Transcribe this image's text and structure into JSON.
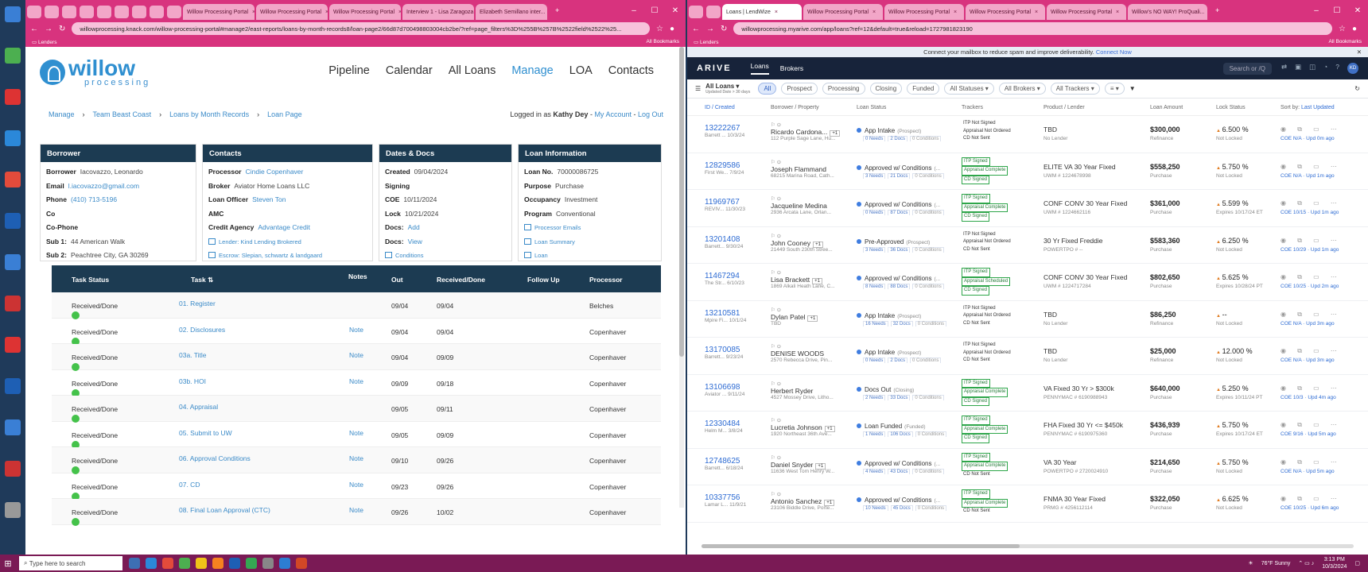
{
  "left_browser": {
    "tabs": [
      "Willow Processing Portal",
      "Willow Processing Portal",
      "Willow Processing Portal",
      "Interview 1 - Lisa Zaragoza",
      "Elizabeth Semillano inter..."
    ],
    "url": "willowprocessing.knack.com/willow-processing-portal#manage2/east-reports/loans-by-month-records8/loan-page2/66d87d700498803004cb2be/?ref=page_filters%3D%255B%257B%2522field%2522%25...",
    "bookmarks_folder": "Lenders",
    "all_bookmarks": "All Bookmarks"
  },
  "logo": {
    "word": "willow",
    "sub": "processing"
  },
  "main_nav": [
    "Pipeline",
    "Calendar",
    "All Loans",
    "Manage",
    "LOA",
    "Contacts"
  ],
  "active_nav": "Manage",
  "breadcrumb": [
    "Manage",
    "Team Beast Coast",
    "Loans by Month Records",
    "Loan Page"
  ],
  "login": {
    "prefix": "Logged in as",
    "user": "Kathy Dey",
    "account": "My Account",
    "logout": "Log Out"
  },
  "borrower": {
    "title": "Borrower",
    "rows": [
      {
        "label": "Borrower",
        "value": "Iacovazzo, Leonardo",
        "link": false
      },
      {
        "label": "Email",
        "value": "l.iacovazzo@gmail.com",
        "link": true
      },
      {
        "label": "Phone",
        "value": "(410) 713-5196",
        "link": true
      },
      {
        "label": "Co",
        "value": "",
        "link": false
      },
      {
        "label": "Co-Phone",
        "value": "",
        "link": false
      },
      {
        "label": "Sub 1:",
        "value": "44 American Walk",
        "link": false
      },
      {
        "label": "Sub 2:",
        "value": "Peachtree City, GA 30269",
        "link": false
      }
    ]
  },
  "contacts": {
    "title": "Contacts",
    "rows": [
      {
        "label": "Processor",
        "value": "Cindie Copenhaver",
        "link": true
      },
      {
        "label": "Broker",
        "value": "Aviator Home Loans LLC",
        "link": false
      },
      {
        "label": "Loan Officer",
        "value": "Steven Ton",
        "link": true
      },
      {
        "label": "AMC",
        "value": "",
        "link": false
      },
      {
        "label": "Credit Agency",
        "value": "Advantage Credit",
        "link": true
      }
    ],
    "links": [
      "Lender: Kind Lending Brokered",
      "Escrow: Slepian, schwartz & landgaard"
    ]
  },
  "dates": {
    "title": "Dates & Docs",
    "rows": [
      {
        "label": "Created",
        "value": "09/04/2024",
        "link": false
      },
      {
        "label": "Signing",
        "value": "",
        "link": false
      },
      {
        "label": "COE",
        "value": "10/11/2024",
        "link": false
      },
      {
        "label": "Lock",
        "value": "10/21/2024",
        "link": false
      },
      {
        "label": "Docs:",
        "value": "Add",
        "link": true
      },
      {
        "label": "Docs:",
        "value": "View",
        "link": true
      }
    ],
    "link": "Conditions"
  },
  "loan_info": {
    "title": "Loan Information",
    "rows": [
      {
        "label": "Loan No.",
        "value": "70000086725"
      },
      {
        "label": "Purpose",
        "value": "Purchase"
      },
      {
        "label": "Occupancy",
        "value": "Investment"
      },
      {
        "label": "Program",
        "value": "Conventional"
      }
    ],
    "links": [
      "Processor Emails",
      "Loan Summary",
      "Loan"
    ]
  },
  "task_table": {
    "headers": {
      "status": "Task Status",
      "task": "Task",
      "notes": "Notes",
      "out": "Out",
      "received": "Received/Done",
      "follow": "Follow Up",
      "processor": "Processor"
    },
    "rows": [
      {
        "status": "Received/Done",
        "task": "01. Register",
        "note": "",
        "out": "09/04",
        "received": "09/04",
        "processor": "Belches"
      },
      {
        "status": "Received/Done",
        "task": "02. Disclosures",
        "note": "Note",
        "out": "09/04",
        "received": "09/04",
        "processor": "Copenhaver"
      },
      {
        "status": "Received/Done",
        "task": "03a. Title",
        "note": "Note",
        "out": "09/04",
        "received": "09/09",
        "processor": "Copenhaver"
      },
      {
        "status": "Received/Done",
        "task": "03b. HOI",
        "note": "Note",
        "out": "09/09",
        "received": "09/18",
        "processor": "Copenhaver"
      },
      {
        "status": "Received/Done",
        "task": "04. Appraisal",
        "note": "",
        "out": "09/05",
        "received": "09/11",
        "processor": "Copenhaver"
      },
      {
        "status": "Received/Done",
        "task": "05. Submit to UW",
        "note": "Note",
        "out": "09/05",
        "received": "09/09",
        "processor": "Copenhaver"
      },
      {
        "status": "Received/Done",
        "task": "06. Approval Conditions",
        "note": "Note",
        "out": "09/10",
        "received": "09/26",
        "processor": "Copenhaver"
      },
      {
        "status": "Received/Done",
        "task": "07. CD",
        "note": "Note",
        "out": "09/23",
        "received": "09/26",
        "processor": "Copenhaver"
      },
      {
        "status": "Received/Done",
        "task": "08. Final Loan Approval (CTC)",
        "note": "Note",
        "out": "09/26",
        "received": "10/02",
        "processor": "Copenhaver"
      }
    ]
  },
  "right_browser": {
    "tabs": [
      "Loans | LendWize",
      "Willow Processing Portal",
      "Willow Processing Portal",
      "Willow Processing Portal",
      "Willow Processing Portal",
      "Willow's NO WAY! ProQuali..."
    ],
    "url": "willowprocessing.myarive.com/app/loans?ref=12&default=true&reload=1727981823190",
    "bookmarks_folder": "Lenders",
    "all_bookmarks": "All Bookmarks"
  },
  "arive": {
    "notice": "Connect your mailbox to reduce spam and improve deliverability.",
    "notice_link": "Connect Now",
    "logo": "ARIVE",
    "tabs": [
      "Loans",
      "Brokers"
    ],
    "search": "Search or /Q",
    "avatar": "KD",
    "view_label": "All Loans",
    "view_sub": "Updated Date > 30 days",
    "filters": [
      "All",
      "Prospect",
      "Processing",
      "Closing",
      "Funded"
    ],
    "dropdowns": [
      "All Statuses",
      "All Brokers",
      "All Trackers"
    ],
    "columns": [
      "ID / Created",
      "Borrower / Property",
      "Loan Status",
      "Trackers",
      "Product / Lender",
      "Loan Amount",
      "Lock Status",
      "Sort by:",
      "Last Updated"
    ],
    "loans": [
      {
        "id": "13222267",
        "sub": "Barrett ... 10/3/24",
        "borrower": "Ricardo Cardona...",
        "plus": "+1",
        "addr": "112 Purple Sage Lane, Hu...",
        "status": "App Intake",
        "stage": "(Prospect)",
        "needs": "0 Needs",
        "docs": "2 Docs",
        "cond": "0 Conditions",
        "trk": [
          "ITP Not Signed",
          "Appraisal Not Ordered",
          "CD Not Sent"
        ],
        "trk_ok": [
          false,
          false,
          false
        ],
        "product": "TBD",
        "lender": "No Lender",
        "amount": "$300,000",
        "purpose": "Refinance",
        "rate": "6.500 %",
        "lock": "Not Locked",
        "upd": "COE N/A · Upd 0m ago"
      },
      {
        "id": "12829586",
        "sub": "First We... 7/9/24",
        "borrower": "Joseph Flammand",
        "plus": "",
        "addr": "68215 Marina Road, Cath...",
        "status": "Approved w/ Conditions",
        "stage": "(...",
        "needs": "3 Needs",
        "docs": "21 Docs",
        "cond": "0 Conditions",
        "trk": [
          "ITP Signed",
          "Appraisal Complete",
          "CD Signed"
        ],
        "trk_ok": [
          true,
          true,
          true
        ],
        "product": "ELITE VA 30 Year Fixed",
        "lender": "UWM # 1224678998",
        "amount": "$558,250",
        "purpose": "Purchase",
        "rate": "5.750 %",
        "lock": "Not Locked",
        "upd": "COE N/A · Upd 1m ago"
      },
      {
        "id": "11969767",
        "sub": "REVIV... 11/30/23",
        "borrower": "Jacqueline Medina",
        "plus": "",
        "addr": "2936 Arcata Lane, Orlan...",
        "status": "Approved w/ Conditions",
        "stage": "(...",
        "needs": "0 Needs",
        "docs": "87 Docs",
        "cond": "0 Conditions",
        "trk": [
          "ITP Signed",
          "Appraisal Complete",
          "CD Signed"
        ],
        "trk_ok": [
          true,
          true,
          true
        ],
        "product": "CONF CONV 30 Year Fixed",
        "lender": "UWM # 1224662116",
        "amount": "$361,000",
        "purpose": "Purchase",
        "rate": "5.599 %",
        "lock": "Expires 10/17/24 ET",
        "upd": "COE 10/15 · Upd 1m ago"
      },
      {
        "id": "13201408",
        "sub": "Barrett... 9/30/24",
        "borrower": "John Cooney",
        "plus": "+1",
        "addr": "21449 South 230th Stree...",
        "status": "Pre-Approved",
        "stage": "(Prospect)",
        "needs": "3 Needs",
        "docs": "36 Docs",
        "cond": "0 Conditions",
        "trk": [
          "ITP Not Signed",
          "Appraisal Not Ordered",
          "CD Not Sent"
        ],
        "trk_ok": [
          false,
          false,
          false
        ],
        "product": "30 Yr Fixed Freddie",
        "lender": "POWERTPO # --",
        "amount": "$583,360",
        "purpose": "Purchase",
        "rate": "6.250 %",
        "lock": "Not Locked",
        "upd": "COE 10/29 · Upd 1m ago"
      },
      {
        "id": "11467294",
        "sub": "The Str... 6/10/23",
        "borrower": "Lisa Brackett",
        "plus": "+1",
        "addr": "1869 Alkali Heath Lane, C...",
        "status": "Approved w/ Conditions",
        "stage": "(...",
        "needs": "8 Needs",
        "docs": "88 Docs",
        "cond": "0 Conditions",
        "trk": [
          "ITP Signed",
          "Appraisal Scheduled",
          "CD Signed"
        ],
        "trk_ok": [
          true,
          true,
          true
        ],
        "product": "CONF CONV 30 Year Fixed",
        "lender": "UWM # 1224717284",
        "amount": "$802,650",
        "purpose": "Purchase",
        "rate": "5.625 %",
        "lock": "Expires 10/28/24 PT",
        "upd": "COE 10/25 · Upd 2m ago"
      },
      {
        "id": "13210581",
        "sub": "Mpire Fi... 10/1/24",
        "borrower": "Dylan Patel",
        "plus": "+1",
        "addr": "TBD",
        "status": "App Intake",
        "stage": "(Prospect)",
        "needs": "16 Needs",
        "docs": "32 Docs",
        "cond": "0 Conditions",
        "trk": [
          "ITP Not Signed",
          "Appraisal Not Ordered",
          "CD Not Sent"
        ],
        "trk_ok": [
          false,
          false,
          false
        ],
        "product": "TBD",
        "lender": "No Lender",
        "amount": "$86,250",
        "purpose": "Refinance",
        "rate": "--",
        "lock": "Not Locked",
        "upd": "COE N/A · Upd 3m ago"
      },
      {
        "id": "13170085",
        "sub": "Barrett... 9/23/24",
        "borrower": "DENISE WOODS",
        "plus": "",
        "addr": "2570 Rebecca Drive, Pin...",
        "status": "App Intake",
        "stage": "(Prospect)",
        "needs": "0 Needs",
        "docs": "2 Docs",
        "cond": "0 Conditions",
        "trk": [
          "ITP Not Signed",
          "Appraisal Not Ordered",
          "CD Not Sent"
        ],
        "trk_ok": [
          false,
          false,
          false
        ],
        "product": "TBD",
        "lender": "No Lender",
        "amount": "$25,000",
        "purpose": "Refinance",
        "rate": "12.000 %",
        "lock": "Not Locked",
        "upd": "COE N/A · Upd 3m ago"
      },
      {
        "id": "13106698",
        "sub": "Aviator ... 9/11/24",
        "borrower": "Herbert Ryder",
        "plus": "",
        "addr": "4527 Mossey Drive, Litho...",
        "status": "Docs Out",
        "stage": "(Closing)",
        "needs": "2 Needs",
        "docs": "33 Docs",
        "cond": "0 Conditions",
        "trk": [
          "ITP Signed",
          "Appraisal Complete",
          "CD Signed"
        ],
        "trk_ok": [
          true,
          true,
          true
        ],
        "product": "VA Fixed 30 Yr > $300k",
        "lender": "PENNYMAC # 6190988943",
        "amount": "$640,000",
        "purpose": "Purchase",
        "rate": "5.250 %",
        "lock": "Expires 10/11/24 PT",
        "upd": "COE 10/3 · Upd 4m ago"
      },
      {
        "id": "12330484",
        "sub": "Helm M... 3/8/24",
        "borrower": "Lucretia Johnson",
        "plus": "+1",
        "addr": "1920 Northeast 36th Ave...",
        "status": "Loan Funded",
        "stage": "(Funded)",
        "needs": "1 Needs",
        "docs": "106 Docs",
        "cond": "0 Conditions",
        "trk": [
          "ITP Signed",
          "Appraisal Complete",
          "CD Signed"
        ],
        "trk_ok": [
          true,
          true,
          true
        ],
        "product": "FHA Fixed 30 Yr <= $450k",
        "lender": "PENNYMAC # 6190975360",
        "amount": "$436,939",
        "purpose": "Purchase",
        "rate": "5.750 %",
        "lock": "Expires 10/17/24 ET",
        "upd": "COE 9/16 · Upd 5m ago"
      },
      {
        "id": "12748625",
        "sub": "Barrett... 6/18/24",
        "borrower": "Daniel Snyder",
        "plus": "+1",
        "addr": "11636 West Tom Henry W...",
        "status": "Approved w/ Conditions",
        "stage": "(...",
        "needs": "4 Needs",
        "docs": "43 Docs",
        "cond": "0 Conditions",
        "trk": [
          "ITP Signed",
          "Appraisal Complete",
          "CD Not Sent"
        ],
        "trk_ok": [
          true,
          true,
          false
        ],
        "product": "VA 30 Year",
        "lender": "POWERTPO # 2720024910",
        "amount": "$214,650",
        "purpose": "Purchase",
        "rate": "5.750 %",
        "lock": "Not Locked",
        "upd": "COE N/A · Upd 5m ago"
      },
      {
        "id": "10337756",
        "sub": "Lamar L... 11/9/21",
        "borrower": "Antonio Sanchez",
        "plus": "+1",
        "addr": "23106 Biddle Drive, Porte...",
        "status": "Approved w/ Conditions",
        "stage": "(...",
        "needs": "10 Needs",
        "docs": "45 Docs",
        "cond": "0 Conditions",
        "trk": [
          "ITP Signed",
          "Appraisal Complete",
          "CD Not Sent"
        ],
        "trk_ok": [
          true,
          true,
          false
        ],
        "product": "FNMA 30 Year Fixed",
        "lender": "PRMG # 4256112114",
        "amount": "$322,050",
        "purpose": "Purchase",
        "rate": "6.625 %",
        "lock": "Not Locked",
        "upd": "COE 10/25 · Upd 6m ago"
      }
    ]
  },
  "taskbar": {
    "search": "Type here to search",
    "weather": "76°F Sunny",
    "time": "3:13 PM",
    "date": "10/3/2024"
  },
  "colors": {
    "chrome_pink": "#d8337e",
    "willow_blue": "#2f8fd0",
    "card_header": "#1c3b52",
    "arive_nav": "#17233a",
    "taskbar": "#7a1a55"
  }
}
